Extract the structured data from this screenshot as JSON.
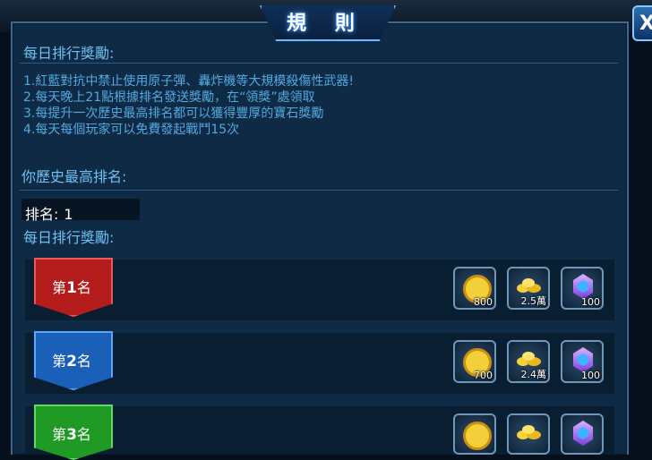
{
  "window": {
    "title": "規 則",
    "close_label": "X"
  },
  "daily_reward_header": "每日排行獎勵:",
  "rules": [
    "1.紅藍對抗中禁止使用原子彈、轟炸機等大規模殺傷性武器!",
    "2.每天晚上21點根據排名發送獎勵，在“領獎”處領取",
    "3.每提升一次歷史最高排名都可以獲得豐厚的寶石獎勵",
    "4.每天每個玩家可以免費發起戰鬥15次"
  ],
  "history_header": "你歷史最高排名:",
  "rank": {
    "label": "排名:",
    "value": "1"
  },
  "daily_header2": "每日排行獎勵:",
  "ranks": [
    {
      "prefix": "第",
      "num": "1",
      "suffix": "名",
      "color": "#b41c1c",
      "rewards": [
        {
          "icon": "coin-icon",
          "qty": "800"
        },
        {
          "icon": "gold-pile-icon",
          "qty": "2.5萬"
        },
        {
          "icon": "gem-icon",
          "qty": "100"
        }
      ]
    },
    {
      "prefix": "第",
      "num": "2",
      "suffix": "名",
      "color": "#1a5fb8",
      "rewards": [
        {
          "icon": "coin-icon",
          "qty": "700"
        },
        {
          "icon": "gold-pile-icon",
          "qty": "2.4萬"
        },
        {
          "icon": "gem-icon",
          "qty": "100"
        }
      ]
    },
    {
      "prefix": "第",
      "num": "3",
      "suffix": "名",
      "color": "#1f9a24",
      "rewards": [
        {
          "icon": "coin-icon",
          "qty": ""
        },
        {
          "icon": "gold-pile-icon",
          "qty": ""
        },
        {
          "icon": "gem-icon",
          "qty": ""
        }
      ]
    }
  ]
}
